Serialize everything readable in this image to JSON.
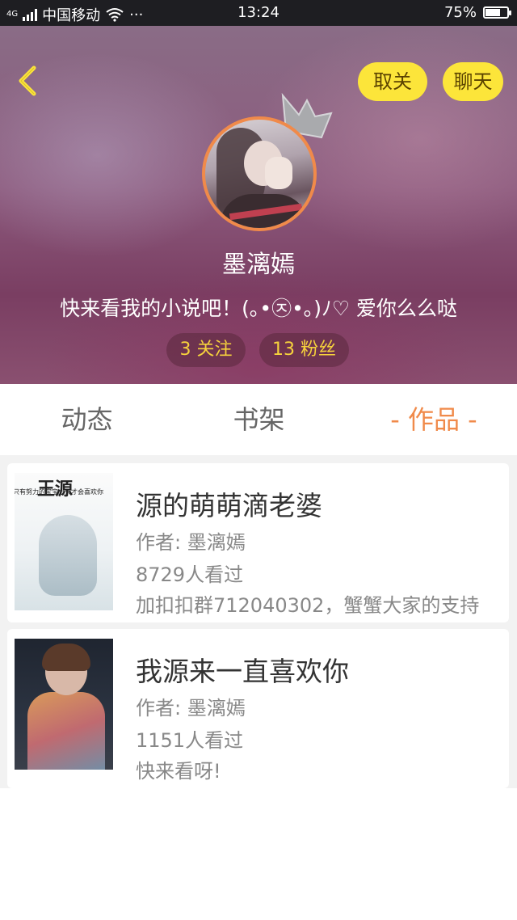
{
  "status_bar": {
    "network_type": "4G",
    "carrier": "中国移动",
    "time": "13:24",
    "battery_percent_text": "75%",
    "battery_level": 0.75
  },
  "header": {
    "unfollow_label": "取关",
    "chat_label": "聊天",
    "username": "墨漓嫣",
    "bio": "快来看我的小说吧！(｡•㉨•｡)ﾉ♡ 爱你么么哒",
    "following_label": "3 关注",
    "fans_label": "13 粉丝",
    "accent_color": "#fce53a",
    "avatar_border_color": "#f08a4a"
  },
  "tabs": [
    {
      "label": "动态",
      "active": false
    },
    {
      "label": "书架",
      "active": false
    },
    {
      "label": "- 作品 -",
      "active": true
    }
  ],
  "works": [
    {
      "cover_title": "王源",
      "cover_subtitle": "只有努力的宝宝上天才会喜欢你",
      "title": "源的萌萌滴老婆",
      "author": "作者: 墨漓嫣",
      "views": "8729人看过",
      "description": "加扣扣群712040302，蟹蟹大家的支持"
    },
    {
      "title": "我源来一直喜欢你",
      "author": "作者: 墨漓嫣",
      "views": "1151人看过",
      "description": "快来看呀!"
    }
  ]
}
